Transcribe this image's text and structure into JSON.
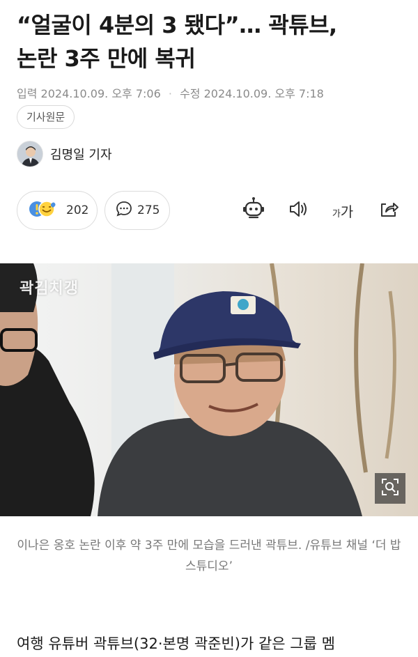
{
  "article": {
    "headline_line1": "“얼굴이 4분의 3 됐다”… 곽튜브,",
    "headline_line2": "논란 3주 만에 복귀",
    "meta": {
      "input_label": "입력",
      "input_time": "2024.10.09. 오후 7:06",
      "edit_label": "수정",
      "edit_time": "2024.10.09. 오후 7:18"
    },
    "origin_button": "기사원문",
    "author": "김명일 기자",
    "reactions_count": "202",
    "comments_count": "275",
    "font_tool": {
      "small": "가",
      "large": "가"
    },
    "photo": {
      "watermark": "곽김치갱"
    },
    "caption": "이나은 옹호 논란 이후 약 3주 만에 모습을 드러낸 곽튜브. /유튜브 채널 ‘더 밥 스튜디오’",
    "body_first_line": "여행 유튜버 곽튜브(32·본명 곽준빈)가 같은 그룹 멤"
  },
  "colors": {
    "headline": "#1a1a1a",
    "meta": "#8a8a8a",
    "border": "#dcdcdc",
    "icon": "#333333"
  },
  "icons": [
    "emoji-reaction-icon",
    "comment-icon",
    "ai-robot-icon",
    "speaker-icon",
    "font-size-icon",
    "share-icon",
    "zoom-icon"
  ]
}
